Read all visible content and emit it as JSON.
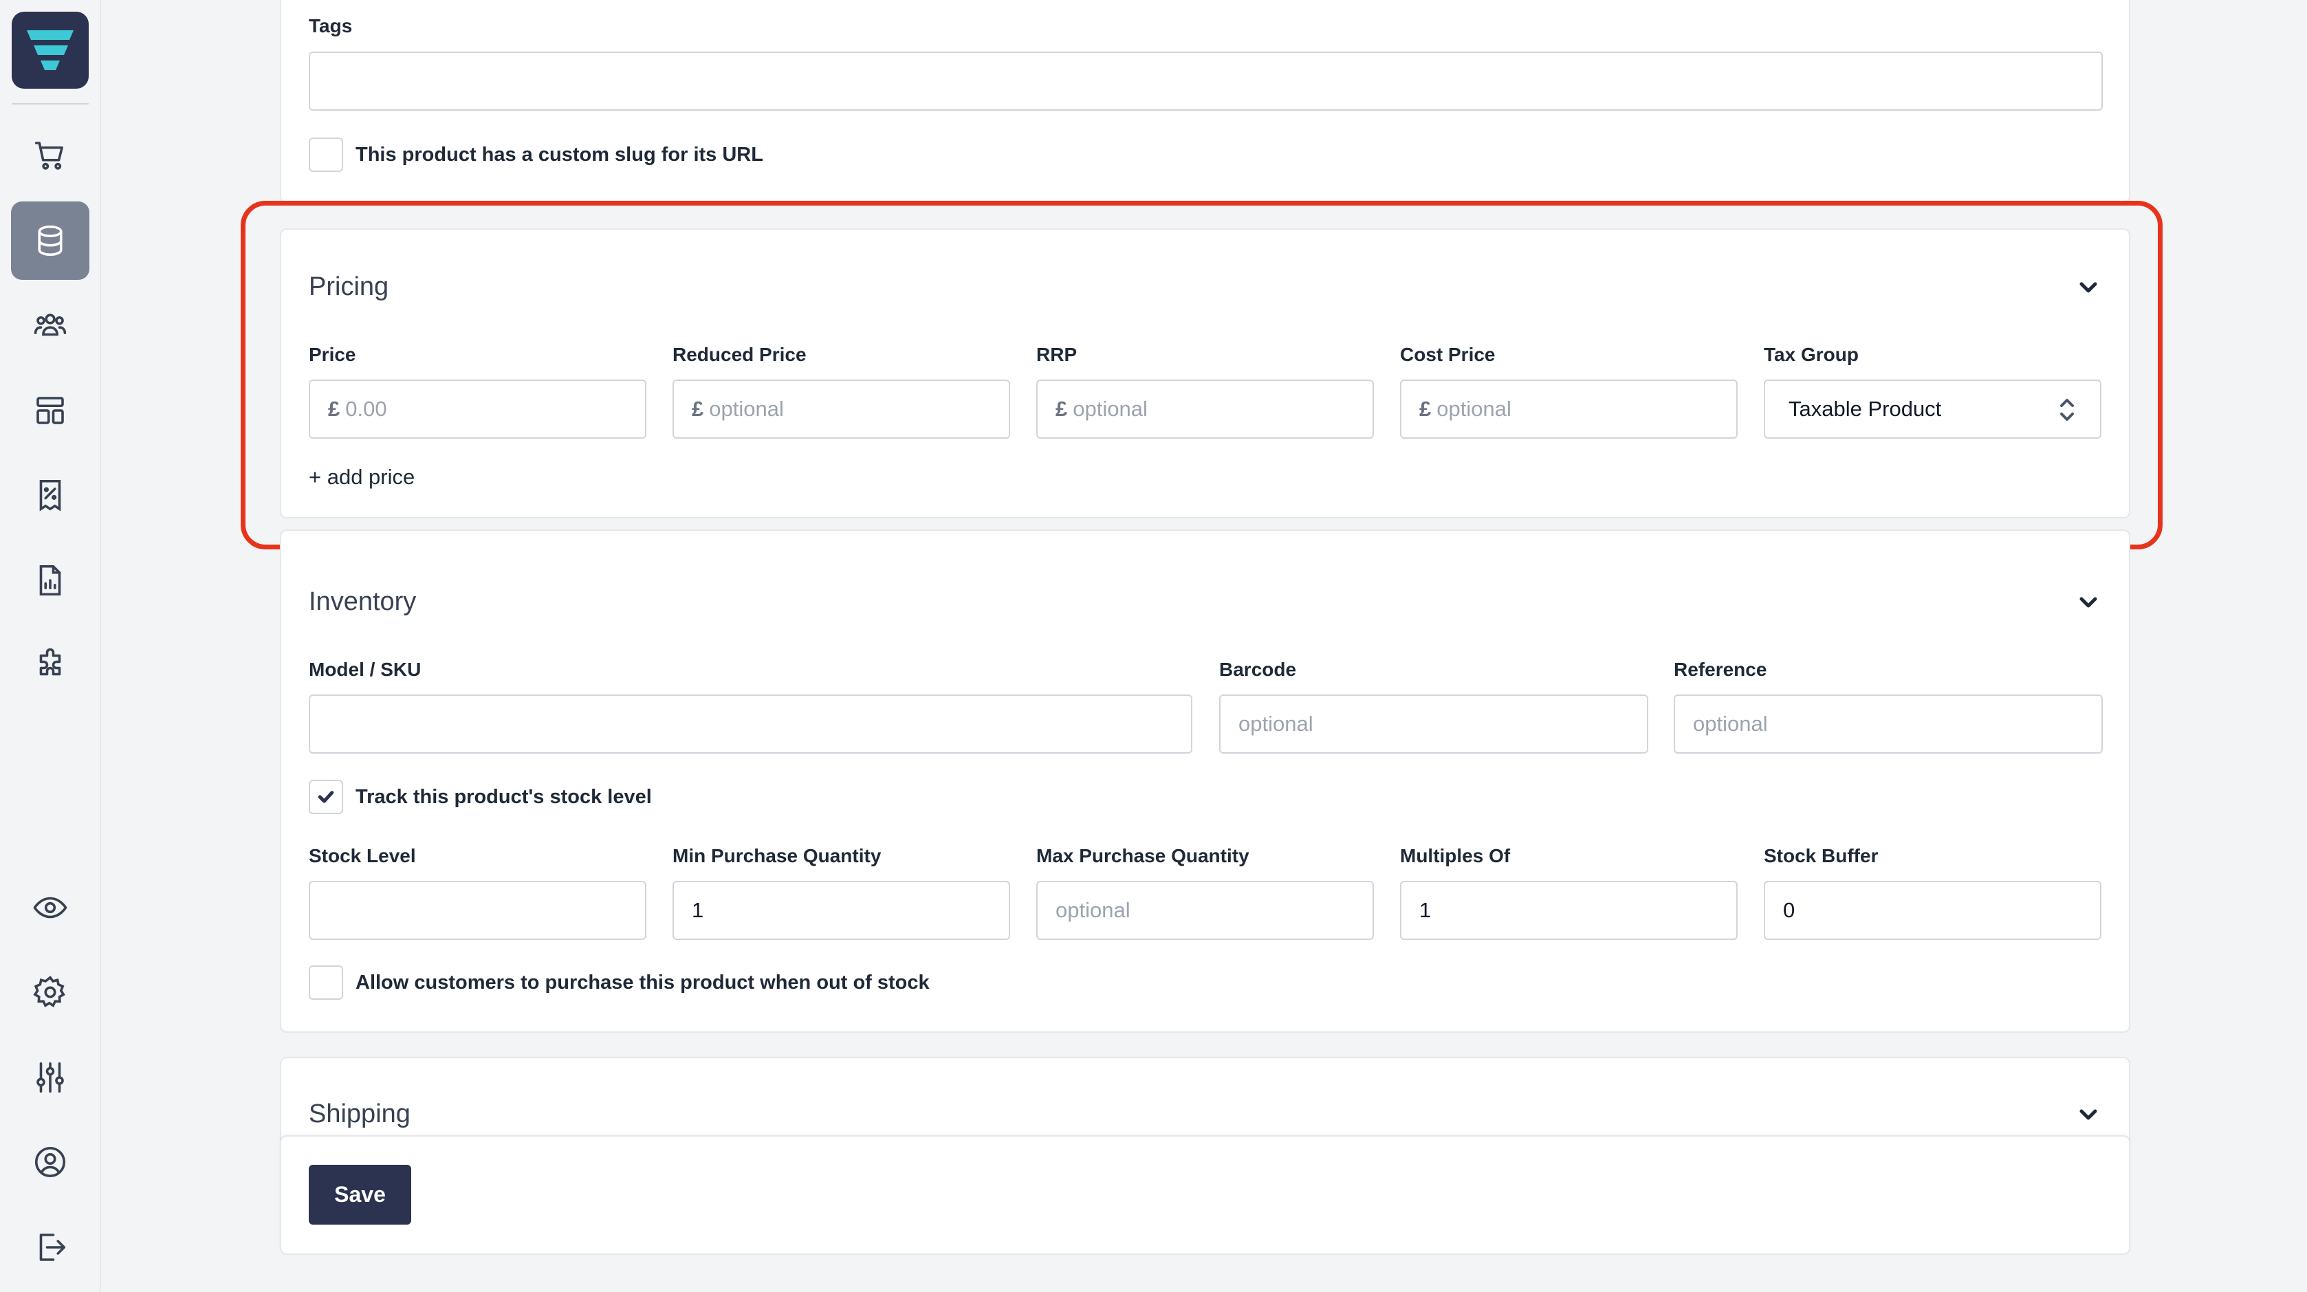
{
  "sidebar": {
    "icons": [
      "logo-icon",
      "cart-icon",
      "database-icon",
      "users-icon",
      "layout-icon",
      "receipt-icon",
      "report-icon",
      "puzzle-icon",
      "eye-icon",
      "gear-icon",
      "sliders-icon",
      "user-circle-icon",
      "logout-icon"
    ]
  },
  "general": {
    "tags_label": "Tags",
    "tags_value": "",
    "custom_slug_label": "This product has a custom slug for its URL"
  },
  "pricing": {
    "title": "Pricing",
    "currency": "£",
    "price_label": "Price",
    "price_placeholder": "0.00",
    "reduced_label": "Reduced Price",
    "reduced_placeholder": "optional",
    "rrp_label": "RRP",
    "rrp_placeholder": "optional",
    "cost_label": "Cost Price",
    "cost_placeholder": "optional",
    "tax_label": "Tax Group",
    "tax_value": "Taxable Product",
    "add_price": "+ add price"
  },
  "inventory": {
    "title": "Inventory",
    "sku_label": "Model / SKU",
    "sku_value": "",
    "barcode_label": "Barcode",
    "barcode_placeholder": "optional",
    "reference_label": "Reference",
    "reference_placeholder": "optional",
    "track_label": "Track this product's stock level",
    "stock_label": "Stock Level",
    "stock_value": "",
    "min_label": "Min Purchase Quantity",
    "min_value": "1",
    "max_label": "Max Purchase Quantity",
    "max_placeholder": "optional",
    "multiples_label": "Multiples Of",
    "multiples_value": "1",
    "buffer_label": "Stock Buffer",
    "buffer_value": "0",
    "backorder_label": "Allow customers to purchase this product when out of stock"
  },
  "shipping": {
    "title": "Shipping"
  },
  "footer": {
    "save_label": "Save"
  },
  "colors": {
    "brand": "#2c3350",
    "accent": "#3ec9d6",
    "highlight": "#e8331c"
  }
}
